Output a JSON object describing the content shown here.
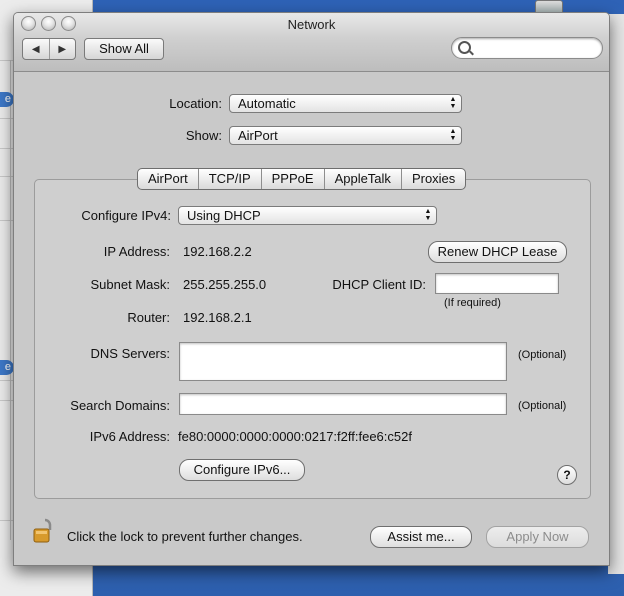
{
  "window": {
    "title": "Network"
  },
  "toolbar": {
    "back_arrow": "◀",
    "forward_arrow": "▶",
    "show_all_label": "Show All",
    "search_placeholder": ""
  },
  "location": {
    "label": "Location:",
    "value": "Automatic"
  },
  "show": {
    "label": "Show:",
    "value": "AirPort"
  },
  "tabs": [
    {
      "label": "AirPort"
    },
    {
      "label": "TCP/IP"
    },
    {
      "label": "PPPoE"
    },
    {
      "label": "AppleTalk"
    },
    {
      "label": "Proxies"
    }
  ],
  "selected_tab": "TCP/IP",
  "tcpip": {
    "configure_ipv4_label": "Configure IPv4:",
    "configure_ipv4_value": "Using DHCP",
    "ip_address_label": "IP Address:",
    "ip_address_value": "192.168.2.2",
    "renew_dhcp_label": "Renew DHCP Lease",
    "subnet_mask_label": "Subnet Mask:",
    "subnet_mask_value": "255.255.255.0",
    "dhcp_client_id_label": "DHCP Client ID:",
    "dhcp_client_id_value": "",
    "if_required_label": "(If required)",
    "router_label": "Router:",
    "router_value": "192.168.2.1",
    "dns_servers_label": "DNS Servers:",
    "dns_servers_value": "",
    "dns_optional_label": "(Optional)",
    "search_domains_label": "Search Domains:",
    "search_domains_value": "",
    "search_domains_optional_label": "(Optional)",
    "ipv6_address_label": "IPv6 Address:",
    "ipv6_address_value": "fe80:0000:0000:0000:0217:f2ff:fee6:c52f",
    "configure_ipv6_label": "Configure IPv6...",
    "help_label": "?"
  },
  "footer": {
    "lock_text": "Click the lock to prevent further changes.",
    "assist_label": "Assist me...",
    "apply_label": "Apply Now"
  },
  "desktop": {
    "sidebar_tab_1": "e",
    "sidebar_tab_2": "e"
  },
  "colors": {
    "desktop": "#2f68b8",
    "window": "#c9c9c9",
    "lock": "#d79a2c"
  },
  "icons": [
    "search-icon",
    "lock-icon",
    "back-arrow-icon",
    "forward-arrow-icon",
    "help-icon",
    "popup-arrows-icon"
  ]
}
